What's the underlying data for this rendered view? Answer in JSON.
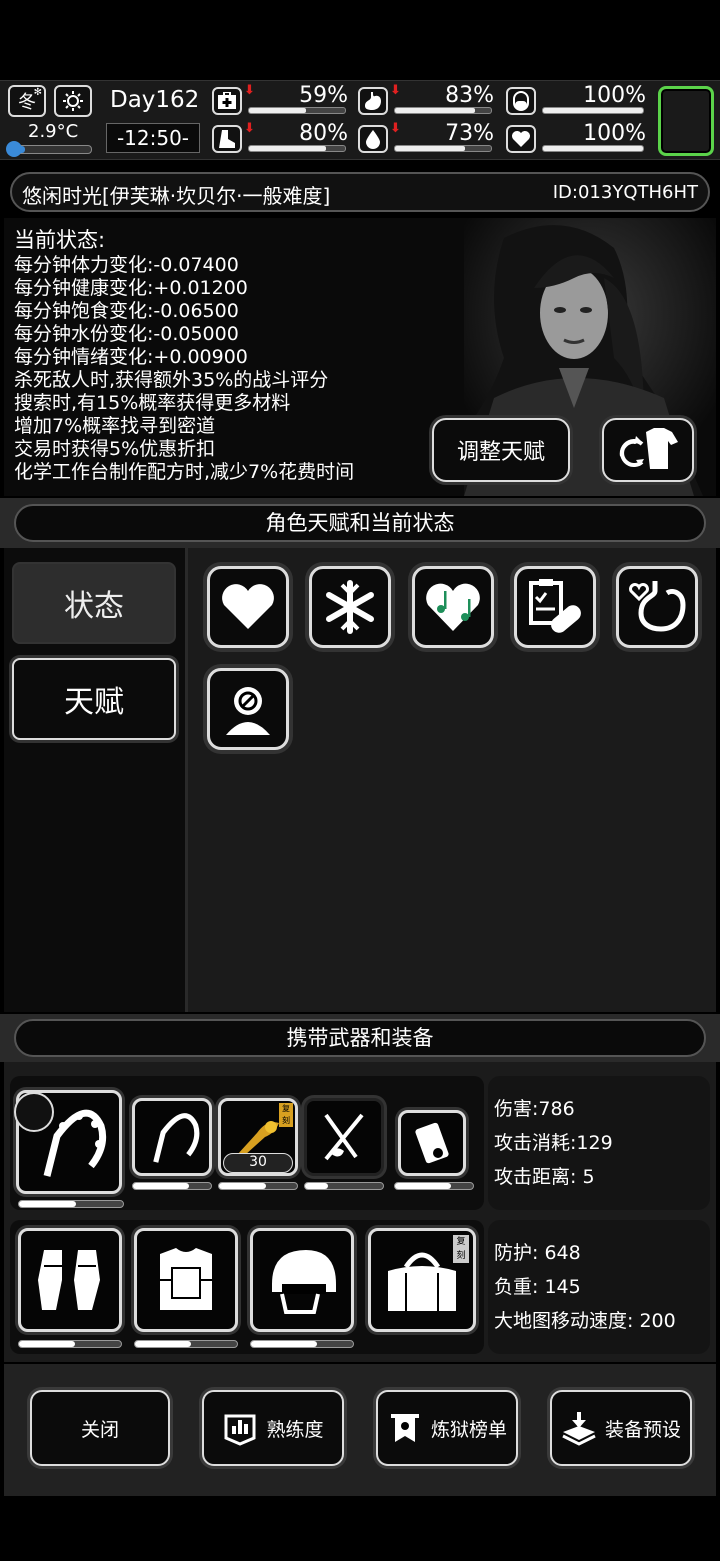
{
  "topbar": {
    "season": "冬",
    "temperature": "2.9°C",
    "day": "Day162",
    "time": "-12:50-",
    "stats": [
      {
        "name": "health",
        "value": "59%",
        "fill": 0.59,
        "down": true
      },
      {
        "name": "hunger",
        "value": "83%",
        "fill": 0.83,
        "down": true
      },
      {
        "name": "pill",
        "value": "100%",
        "fill": 1.0,
        "down": false
      },
      {
        "name": "stamina",
        "value": "80%",
        "fill": 0.8,
        "down": true
      },
      {
        "name": "water",
        "value": "73%",
        "fill": 0.73,
        "down": true
      },
      {
        "name": "mood",
        "value": "100%",
        "fill": 1.0,
        "down": false
      }
    ],
    "accent": "#5bd34a"
  },
  "title": {
    "name": "悠闲时光[伊芙琳·坎贝尔·一般难度]",
    "id": "ID:013YQTH6HT"
  },
  "status": {
    "heading": "当前状态:",
    "lines": [
      "每分钟体力变化:-0.07400",
      "每分钟健康变化:+0.01200",
      "每分钟饱食变化:-0.06500",
      "每分钟水份变化:-0.05000",
      "每分钟情绪变化:+0.00900",
      "杀死敌人时,获得额外35%的战斗评分",
      "搜索时,有15%概率获得更多材料",
      "增加7%概率找寻到密道",
      "交易时获得5%优惠折扣",
      "化学工作台制作配方时,减少7%花费时间"
    ],
    "adjust_talent": "调整天赋"
  },
  "talent_section": {
    "header": "角色天赋和当前状态",
    "tab_status": "状态",
    "tab_talent": "天赋",
    "icons": [
      "heart-icon",
      "snowflake-icon",
      "music-heart-icon",
      "medkit-clipboard-icon",
      "stomach-heart-icon",
      "head-no-icon"
    ]
  },
  "equipment_section": {
    "header": "携带武器和装备",
    "weapon_stats": [
      "伤害:786",
      "攻击消耗:129",
      "攻击距离: 5"
    ],
    "armor_stats": [
      "防护: 648",
      "负重: 145",
      "大地图移动速度: 200"
    ],
    "ammo_count": "30",
    "engraved_label": "复刻",
    "weapon_bars": [
      0.55,
      0.72,
      0.6,
      0.3,
      0.72
    ],
    "armor_bars": [
      0.55,
      0.55,
      0.65
    ]
  },
  "bottom": {
    "close": "关闭",
    "proficiency": "熟练度",
    "ranking": "炼狱榜单",
    "preset": "装备预设"
  }
}
